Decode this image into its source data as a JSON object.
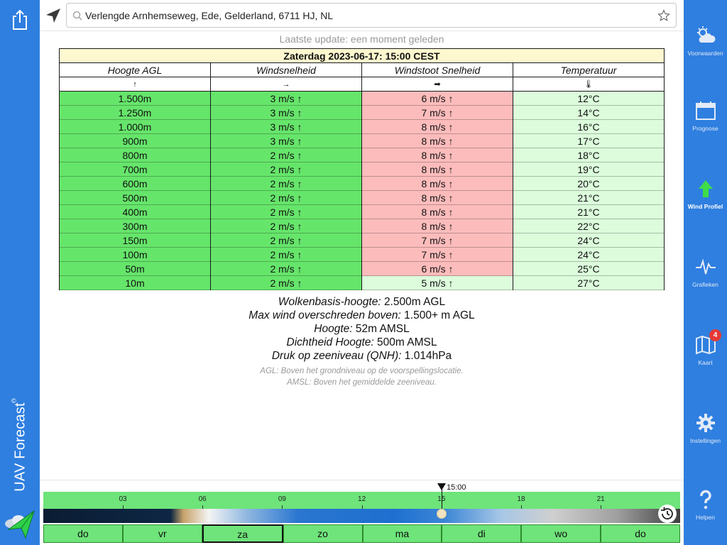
{
  "app": {
    "brand": "UAV Forecast",
    "brand_mark": "©"
  },
  "search": {
    "value": "Verlengde Arnhemseweg, Ede, Gelderland, 6711 HJ, NL",
    "placeholder": ""
  },
  "status": {
    "last_update": "Laatste update: een moment geleden"
  },
  "table": {
    "title": "Zaterdag 2023-06-17: 15:00 CEST",
    "headers": [
      "Hoogte AGL",
      "Windsnelheid",
      "Windstoot Snelheid",
      "Temperatuur"
    ],
    "header_arrows": [
      "↑",
      "→",
      "➡",
      "🌡"
    ],
    "rows": [
      {
        "h": "1.500m",
        "w": "3 m/s ↑",
        "g": "6 m/s ↑",
        "t": "12°C"
      },
      {
        "h": "1.250m",
        "w": "3 m/s ↑",
        "g": "7 m/s ↑",
        "t": "14°C"
      },
      {
        "h": "1.000m",
        "w": "3 m/s ↑",
        "g": "8 m/s ↑",
        "t": "16°C"
      },
      {
        "h": "900m",
        "w": "3 m/s ↑",
        "g": "8 m/s ↑",
        "t": "17°C"
      },
      {
        "h": "800m",
        "w": "2 m/s ↑",
        "g": "8 m/s ↑",
        "t": "18°C"
      },
      {
        "h": "700m",
        "w": "2 m/s ↑",
        "g": "8 m/s ↑",
        "t": "19°C"
      },
      {
        "h": "600m",
        "w": "2 m/s ↑",
        "g": "8 m/s ↑",
        "t": "20°C"
      },
      {
        "h": "500m",
        "w": "2 m/s ↑",
        "g": "8 m/s ↑",
        "t": "21°C"
      },
      {
        "h": "400m",
        "w": "2 m/s ↑",
        "g": "8 m/s ↑",
        "t": "21°C"
      },
      {
        "h": "300m",
        "w": "2 m/s ↑",
        "g": "8 m/s ↑",
        "t": "22°C"
      },
      {
        "h": "150m",
        "w": "2 m/s ↑",
        "g": "7 m/s ↑",
        "t": "24°C"
      },
      {
        "h": "100m",
        "w": "2 m/s ↑",
        "g": "7 m/s ↑",
        "t": "24°C"
      },
      {
        "h": "50m",
        "w": "2 m/s ↑",
        "g": "6 m/s ↑",
        "t": "25°C"
      },
      {
        "h": "10m",
        "w": "2 m/s ↑",
        "g": "5 m/s ↑",
        "t": "27°C"
      }
    ]
  },
  "info": {
    "cloud_label": "Wolkenbasis-hoogte:",
    "cloud_value": "2.500m AGL",
    "maxwind_label": "Max wind overschreden boven:",
    "maxwind_value": "1.500+ m AGL",
    "altitude_label": "Hoogte:",
    "altitude_value": "52m AMSL",
    "density_label": "Dichtheid Hoogte:",
    "density_value": "500m AMSL",
    "qnh_label": "Druk op zeeniveau (QNH):",
    "qnh_value": "1.014hPa",
    "note_agl": "AGL: Boven het grondniveau op de voorspellingslocatie.",
    "note_amsl": "AMSL: Boven het gemiddelde zeeniveau."
  },
  "timeline": {
    "hours": [
      "03",
      "06",
      "09",
      "12",
      "15",
      "18",
      "21"
    ],
    "current_time": "15:00",
    "days": [
      "do",
      "vr",
      "za",
      "zo",
      "ma",
      "di",
      "wo",
      "do"
    ],
    "selected_day_index": 2
  },
  "nav": {
    "items": [
      {
        "label": "Voorwaarden",
        "icon": "weather-icon"
      },
      {
        "label": "Prognose",
        "icon": "calendar-icon"
      },
      {
        "label": "Wind Profiel",
        "icon": "arrow-up-icon"
      },
      {
        "label": "Grafieken",
        "icon": "pulse-icon"
      },
      {
        "label": "Kaart",
        "icon": "map-icon",
        "badge": "4"
      },
      {
        "label": "Instellingen",
        "icon": "gear-icon"
      },
      {
        "label": "Helpen",
        "icon": "help-icon"
      }
    ],
    "active_index": 2
  },
  "colors": {
    "sidebar": "#2f7fe0",
    "green": "#66e56b",
    "red": "#fdbcbc",
    "light_green": "#dcfcdc",
    "title_bg": "#fdf8cf"
  }
}
